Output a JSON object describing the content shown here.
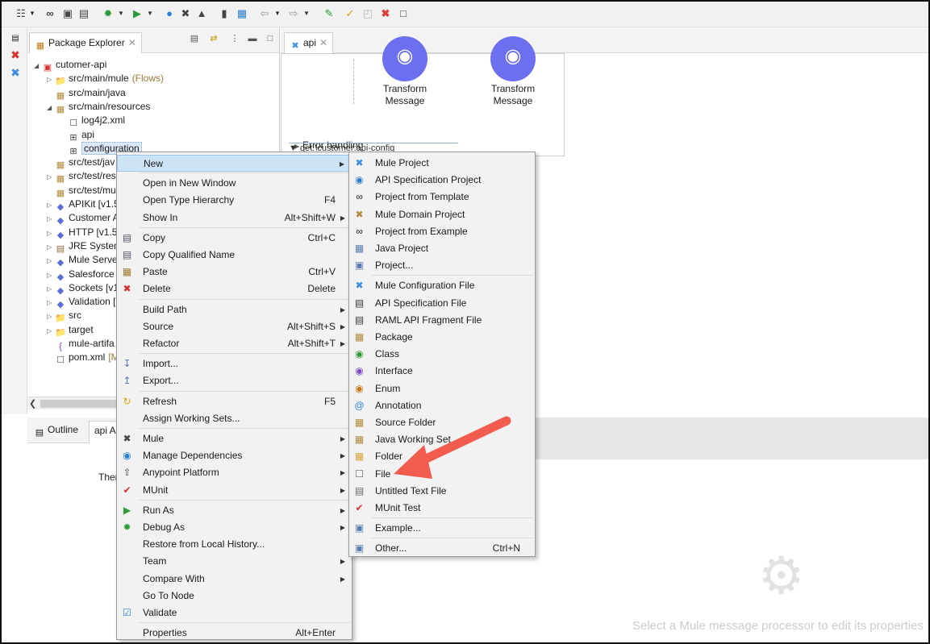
{
  "package_explorer": {
    "tab_label": "Package Explorer",
    "tree": [
      {
        "label": "cutomer-api",
        "expanded": true,
        "icon": "project-icon"
      },
      {
        "label": "src/main/mule",
        "suffix": "(Flows)",
        "icon": "folder-icon"
      },
      {
        "label": "src/main/java",
        "icon": "package-folder-icon"
      },
      {
        "label": "src/main/resources",
        "expanded": true,
        "icon": "package-folder-icon"
      },
      {
        "label": "log4j2.xml",
        "icon": "xml-file-icon"
      },
      {
        "label": "api",
        "icon": "folder-grid-icon"
      },
      {
        "label": "configuration",
        "selected": true,
        "icon": "folder-grid-icon"
      },
      {
        "label": "src/test/jav",
        "icon": "package-folder-icon"
      },
      {
        "label": "src/test/res",
        "icon": "package-folder-icon"
      },
      {
        "label": "src/test/mu",
        "icon": "package-folder-icon"
      },
      {
        "label": "APIKit [v1.5",
        "icon": "library-icon"
      },
      {
        "label": "Customer A",
        "icon": "library-icon"
      },
      {
        "label": "HTTP [v1.5",
        "icon": "library-icon"
      },
      {
        "label": "JRE System",
        "icon": "jre-icon"
      },
      {
        "label": "Mule Serve",
        "icon": "library-icon"
      },
      {
        "label": "Salesforce [",
        "icon": "library-icon"
      },
      {
        "label": "Sockets [v1",
        "icon": "library-icon"
      },
      {
        "label": "Validation [",
        "icon": "library-icon"
      },
      {
        "label": "src",
        "icon": "folder-icon"
      },
      {
        "label": "target",
        "icon": "folder-icon"
      },
      {
        "label": "mule-artifa",
        "icon": "json-file-icon"
      },
      {
        "label": "pom.xml",
        "suffix": "[M",
        "icon": "xml-file-icon"
      }
    ]
  },
  "bottom_panel": {
    "tab_outline": "Outline",
    "tab_api": "api A",
    "text": "Ther"
  },
  "editor": {
    "tab_label": "api",
    "transform_1": "Transform Message",
    "transform_2": "Transform Message",
    "error_handling": "Error handling",
    "config_bar": "get:\\customer:api-config",
    "properties_message": "Select a Mule message processor to edit its properties"
  },
  "context_menu": {
    "items": [
      {
        "label": "New",
        "submenu": true,
        "highlighted": true
      },
      {
        "sep": true
      },
      {
        "label": "Open in New Window"
      },
      {
        "label": "Open Type Hierarchy",
        "shortcut": "F4"
      },
      {
        "label": "Show In",
        "shortcut": "Alt+Shift+W",
        "submenu": true
      },
      {
        "sep": true
      },
      {
        "label": "Copy",
        "shortcut": "Ctrl+C",
        "icon": "copy-icon"
      },
      {
        "label": "Copy Qualified Name",
        "icon": "copy-qualified-icon"
      },
      {
        "label": "Paste",
        "shortcut": "Ctrl+V",
        "icon": "paste-icon"
      },
      {
        "label": "Delete",
        "shortcut": "Delete",
        "icon": "delete-icon"
      },
      {
        "sep": true
      },
      {
        "label": "Build Path",
        "submenu": true
      },
      {
        "label": "Source",
        "shortcut": "Alt+Shift+S",
        "submenu": true
      },
      {
        "label": "Refactor",
        "shortcut": "Alt+Shift+T",
        "submenu": true
      },
      {
        "sep": true
      },
      {
        "label": "Import...",
        "icon": "import-icon"
      },
      {
        "label": "Export...",
        "icon": "export-icon"
      },
      {
        "sep": true
      },
      {
        "label": "Refresh",
        "shortcut": "F5",
        "icon": "refresh-icon"
      },
      {
        "label": "Assign Working Sets..."
      },
      {
        "sep": true
      },
      {
        "label": "Mule",
        "submenu": true,
        "icon": "mule-icon"
      },
      {
        "label": "Manage Dependencies",
        "submenu": true,
        "icon": "dependencies-icon"
      },
      {
        "label": "Anypoint Platform",
        "submenu": true,
        "icon": "anypoint-icon"
      },
      {
        "label": "MUnit",
        "submenu": true,
        "icon": "munit-icon"
      },
      {
        "sep": true
      },
      {
        "label": "Run As",
        "submenu": true,
        "icon": "run-icon"
      },
      {
        "label": "Debug As",
        "submenu": true,
        "icon": "debug-icon"
      },
      {
        "label": "Restore from Local History..."
      },
      {
        "label": "Team",
        "submenu": true
      },
      {
        "label": "Compare With",
        "submenu": true
      },
      {
        "label": "Go To Node"
      },
      {
        "label": "Validate",
        "icon": "check-icon"
      },
      {
        "sep": true
      },
      {
        "label": "Properties",
        "shortcut": "Alt+Enter"
      }
    ]
  },
  "new_submenu": {
    "items": [
      {
        "label": "Mule Project",
        "icon": "mule-project-icon"
      },
      {
        "label": "API Specification Project",
        "icon": "api-spec-project-icon"
      },
      {
        "label": "Project from Template",
        "icon": "template-icon"
      },
      {
        "label": "Mule Domain Project",
        "icon": "mule-domain-icon"
      },
      {
        "label": "Project from Example",
        "icon": "example-project-icon"
      },
      {
        "label": "Java Project",
        "icon": "java-project-icon"
      },
      {
        "label": "Project...",
        "icon": "project-icon"
      },
      {
        "sep": true
      },
      {
        "label": "Mule Configuration File",
        "icon": "mule-config-icon"
      },
      {
        "label": "API Specification File",
        "icon": "api-file-icon"
      },
      {
        "label": "RAML API Fragment File",
        "icon": "raml-icon"
      },
      {
        "label": "Package",
        "icon": "package-icon"
      },
      {
        "label": "Class",
        "icon": "class-icon"
      },
      {
        "label": "Interface",
        "icon": "interface-icon"
      },
      {
        "label": "Enum",
        "icon": "enum-icon"
      },
      {
        "label": "Annotation",
        "icon": "annotation-icon"
      },
      {
        "label": "Source Folder",
        "icon": "source-folder-icon"
      },
      {
        "label": "Java Working Set",
        "icon": "working-set-icon"
      },
      {
        "label": "Folder",
        "icon": "folder-icon"
      },
      {
        "label": "File",
        "icon": "file-icon"
      },
      {
        "label": "Untitled Text File",
        "icon": "text-file-icon"
      },
      {
        "label": "MUnit Test",
        "icon": "munit-test-icon"
      },
      {
        "sep": true
      },
      {
        "label": "Example...",
        "icon": "example-icon"
      },
      {
        "sep": true
      },
      {
        "label": "Other...",
        "shortcut": "Ctrl+N",
        "icon": "other-icon"
      }
    ]
  },
  "colors": {
    "accent_arrow": "#f25c4f",
    "menu_highlight": "#cde4f7",
    "mule_node": "#6b6ff0"
  }
}
